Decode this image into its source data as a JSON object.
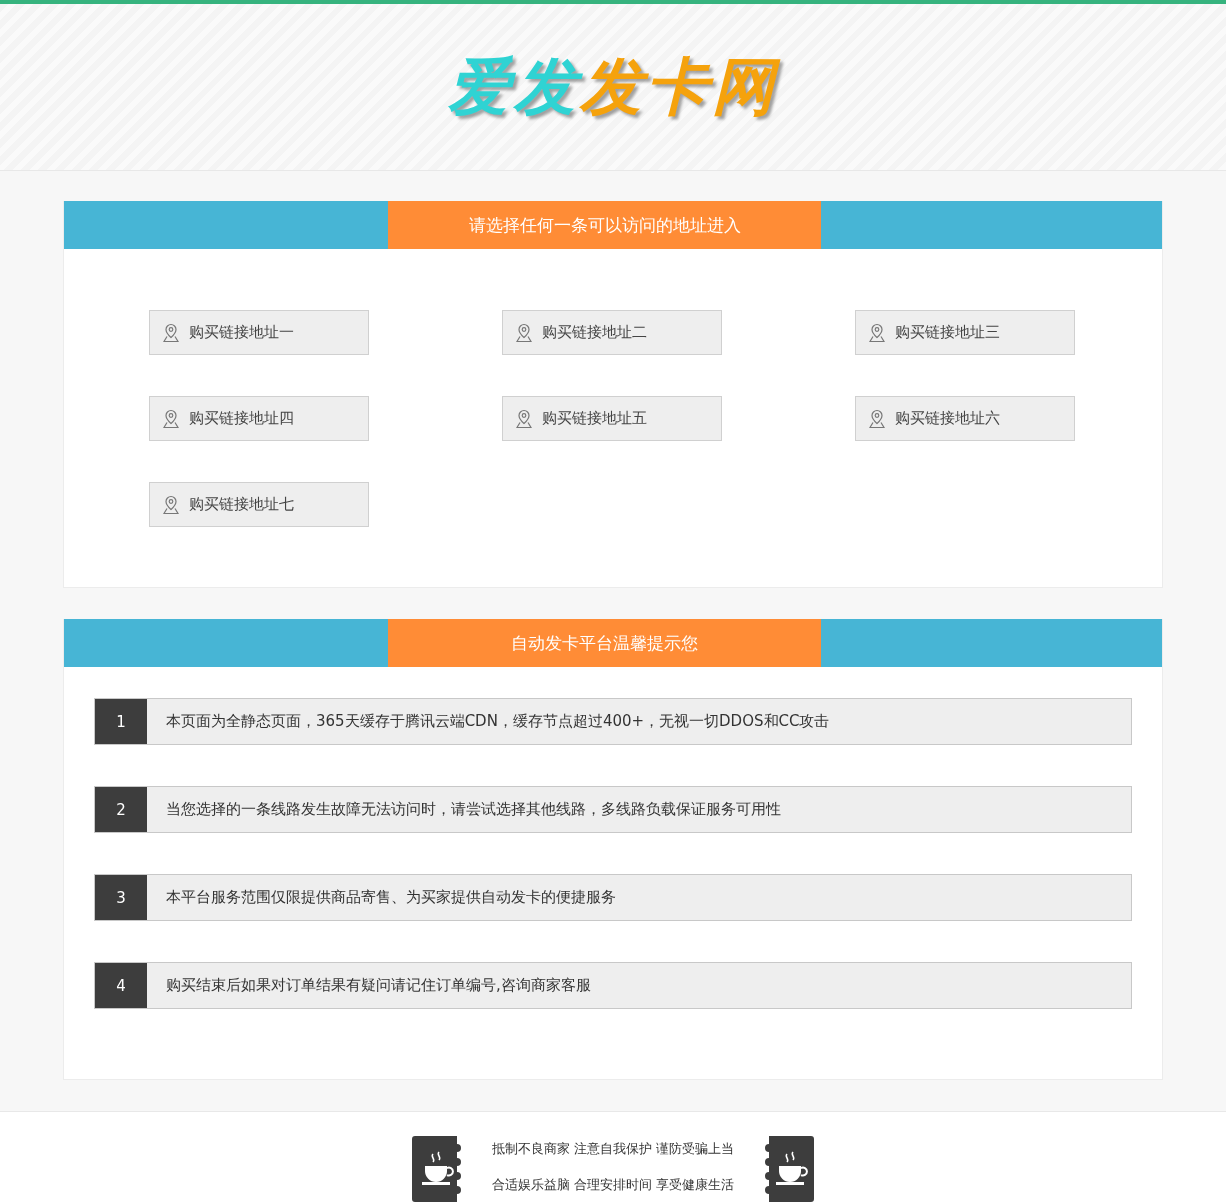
{
  "logo": [
    {
      "text": "爱发",
      "color": "#2fd3d3"
    },
    {
      "text": "发卡网",
      "color": "#f5a20c"
    }
  ],
  "links_panel": {
    "title": "请选择任何一条可以访问的地址进入",
    "links": [
      "购买链接地址一",
      "购买链接地址二",
      "购买链接地址三",
      "购买链接地址四",
      "购买链接地址五",
      "购买链接地址六",
      "购买链接地址七"
    ]
  },
  "notice_panel": {
    "title": "自动发卡平台温馨提示您",
    "items": [
      {
        "number": "1",
        "text": "本页面为全静态页面，365天缓存于腾讯云端CDN，缓存节点超过400+，无视一切DDOS和CC攻击"
      },
      {
        "number": "2",
        "text": "当您选择的一条线路发生故障无法访问时，请尝试选择其他线路，多线路负载保证服务可用性"
      },
      {
        "number": "3",
        "text": "本平台服务范围仅限提供商品寄售、为买家提供自动发卡的便捷服务"
      },
      {
        "number": "4",
        "text": "购买结束后如果对订单结果有疑问请记住订单编号,咨询商家客服"
      }
    ]
  },
  "footer": {
    "lines": [
      "抵制不良商家 注意自我保护 谨防受骗上当",
      "合适娱乐益脑 合理安排时间 享受健康生活"
    ]
  }
}
